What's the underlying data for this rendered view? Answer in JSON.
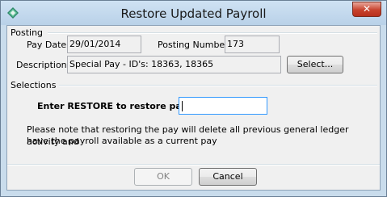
{
  "window": {
    "title": "Restore Updated Payroll",
    "close_label": "✕"
  },
  "posting": {
    "section_label": "Posting",
    "pay_date_label": "Pay Date:",
    "pay_date_value": "29/01/2014",
    "posting_number_label": "Posting Number:",
    "posting_number_value": "173",
    "description_label": "Description:",
    "description_value": "Special Pay - ID's: 18363, 18365",
    "select_button": "Select..."
  },
  "selections": {
    "section_label": "Selections",
    "restore_prompt": "Enter RESTORE to restore pay:",
    "restore_value": "",
    "note_line1": "Please note that restoring the pay will delete all previous general ledger activity and",
    "note_line2": "have the payroll available as a current pay"
  },
  "buttons": {
    "ok": "OK",
    "cancel": "Cancel"
  },
  "icons": {
    "app": "diamond-app-icon",
    "close": "close-icon"
  }
}
